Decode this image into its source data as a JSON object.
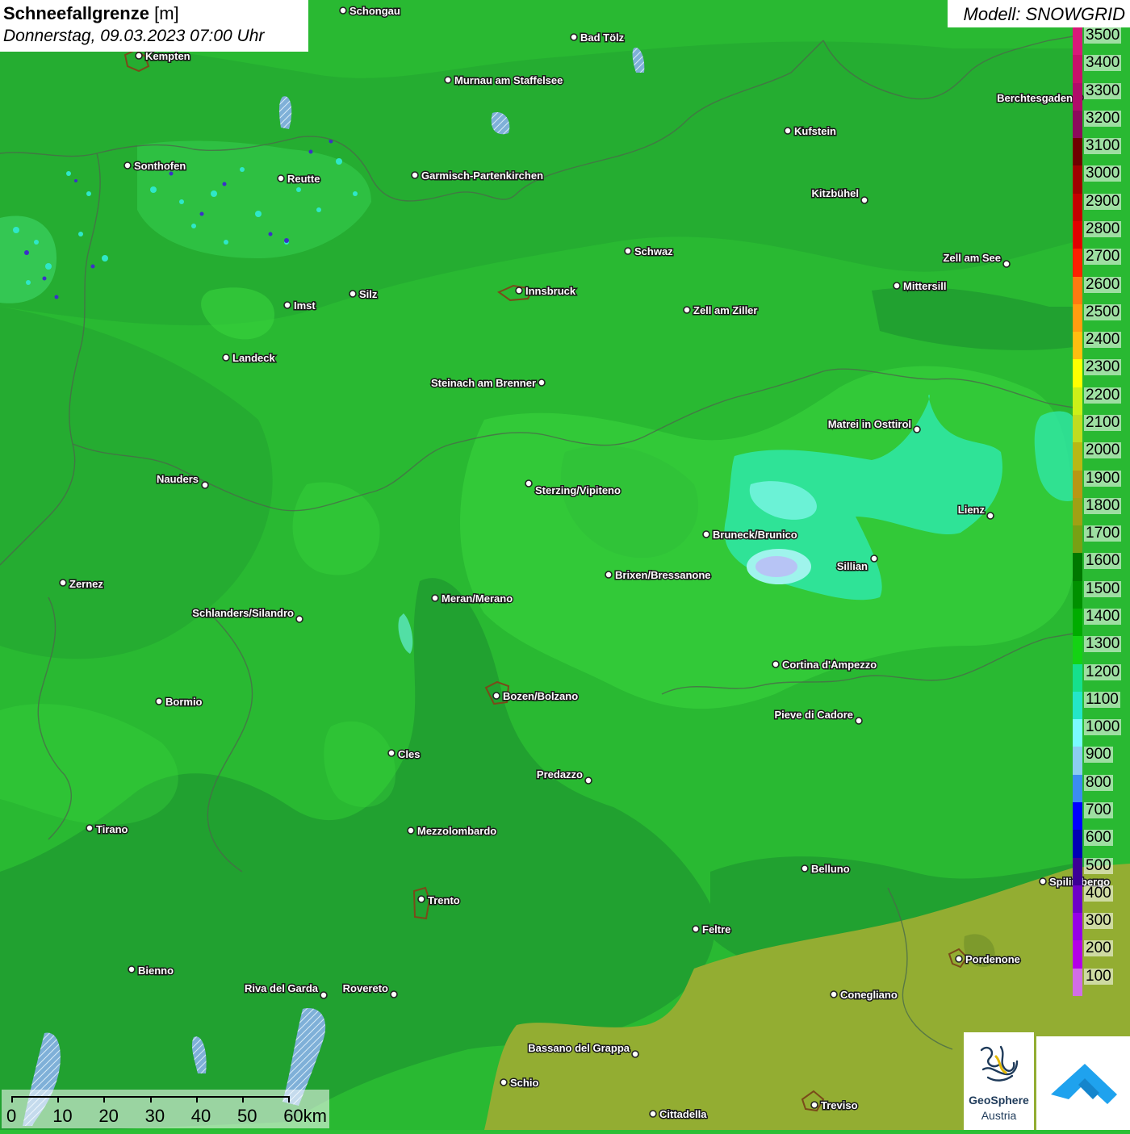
{
  "header": {
    "title": "Schneefallgrenze",
    "unit": "[m]",
    "datetime": "Donnerstag, 09.03.2023 07:00 Uhr"
  },
  "model": {
    "label": "Modell: SNOWGRID"
  },
  "legend": {
    "levels": [
      "3500",
      "3400",
      "3300",
      "3200",
      "3100",
      "3000",
      "2900",
      "2800",
      "2700",
      "2600",
      "2500",
      "2400",
      "2300",
      "2200",
      "2100",
      "2000",
      "1900",
      "1800",
      "1700",
      "1600",
      "1500",
      "1400",
      "1300",
      "1200",
      "1100",
      "1000",
      "900",
      "800",
      "700",
      "600",
      "500",
      "400",
      "300",
      "200",
      "100"
    ],
    "colors": [
      "#d8197a",
      "#c8106a",
      "#b00c6a",
      "#8c0a5c",
      "#6e0000",
      "#a00000",
      "#c40000",
      "#e00000",
      "#ff2000",
      "#ff7a10",
      "#ff9d10",
      "#ffbe10",
      "#ffff00",
      "#ccf018",
      "#c0dc20",
      "#b8b814",
      "#b89614",
      "#a0a014",
      "#78a014",
      "#007800",
      "#009000",
      "#00ac00",
      "#14d214",
      "#16e08c",
      "#24e6c8",
      "#7afaff",
      "#8ccdf0",
      "#3c8cf0",
      "#0000ff",
      "#0000b4",
      "#3c0096",
      "#6e00c8",
      "#9600e6",
      "#b400e6",
      "#d26ee6"
    ]
  },
  "cities": [
    {
      "name": "Schongau"
    },
    {
      "name": "Bad Tölz"
    },
    {
      "name": "Kempten"
    },
    {
      "name": "Murnau am Staffelsee"
    },
    {
      "name": "Berchtesgaden"
    },
    {
      "name": "Kufstein"
    },
    {
      "name": "Sonthofen"
    },
    {
      "name": "Reutte"
    },
    {
      "name": "Garmisch-Partenkirchen"
    },
    {
      "name": "Kitzbühel"
    },
    {
      "name": "Schwaz"
    },
    {
      "name": "Zell am See"
    },
    {
      "name": "Mittersill"
    },
    {
      "name": "Innsbruck"
    },
    {
      "name": "Silz"
    },
    {
      "name": "Imst"
    },
    {
      "name": "Zell am Ziller"
    },
    {
      "name": "Landeck"
    },
    {
      "name": "Steinach am Brenner"
    },
    {
      "name": "Matrei in Osttirol"
    },
    {
      "name": "Nauders"
    },
    {
      "name": "Sterzing/Vipiteno"
    },
    {
      "name": "Lienz"
    },
    {
      "name": "Bruneck/Brunico"
    },
    {
      "name": "Sillian"
    },
    {
      "name": "Brixen/Bressanone"
    },
    {
      "name": "Zernez"
    },
    {
      "name": "Meran/Merano"
    },
    {
      "name": "Schlanders/Silandro"
    },
    {
      "name": "Cortina d'Ampezzo"
    },
    {
      "name": "Bozen/Bolzano"
    },
    {
      "name": "Bormio"
    },
    {
      "name": "Pieve di Cadore"
    },
    {
      "name": "Cles"
    },
    {
      "name": "Predazzo"
    },
    {
      "name": "Tirano"
    },
    {
      "name": "Mezzolombardo"
    },
    {
      "name": "Belluno"
    },
    {
      "name": "Spilimbergo"
    },
    {
      "name": "Trento"
    },
    {
      "name": "Feltre"
    },
    {
      "name": "Pordenone"
    },
    {
      "name": "Bienno"
    },
    {
      "name": "Riva del Garda"
    },
    {
      "name": "Rovereto"
    },
    {
      "name": "Conegliano"
    },
    {
      "name": "Bassano del Grappa"
    },
    {
      "name": "Schio"
    },
    {
      "name": "Treviso"
    },
    {
      "name": "Cittadella"
    }
  ],
  "scalebar": {
    "labels": [
      "0",
      "10",
      "20",
      "30",
      "40",
      "50",
      "60km"
    ]
  },
  "logo": {
    "name": "GeoSphere",
    "subname": "Austria"
  }
}
